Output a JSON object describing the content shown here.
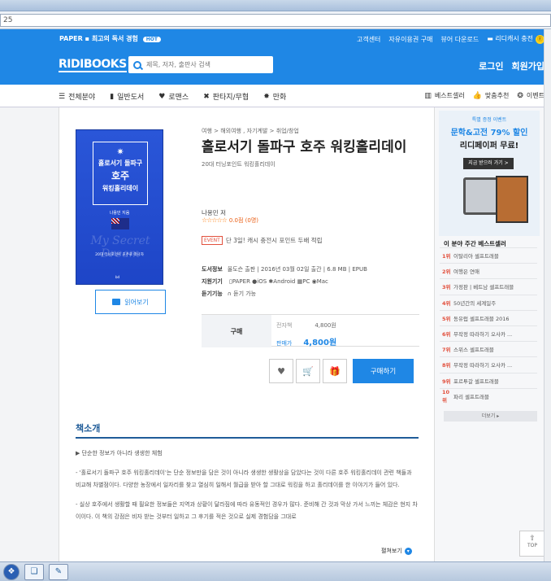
{
  "browser": {
    "address": "25"
  },
  "topstrip": {
    "paper": "PAPER",
    "tagline": "최고의 독서 경험",
    "hot": "HOT",
    "links": [
      "고객센터",
      "자유이용권 구매",
      "뷰어 다운로드"
    ],
    "cash_charge": "리디캐시 충전",
    "coin": "Ⓡ"
  },
  "header": {
    "logo": "RIDIBOOKS",
    "search_placeholder": "제목, 저자, 출판사 검색",
    "login": "로그인",
    "signup": "회원가입"
  },
  "nav": {
    "left": [
      {
        "label": "전체분야",
        "icon": "menu-icon"
      },
      {
        "label": "일반도서",
        "icon": "book-icon"
      },
      {
        "label": "로맨스",
        "icon": "heart-icon"
      },
      {
        "label": "판타지/무협",
        "icon": "swords-icon"
      },
      {
        "label": "만화",
        "icon": "burst-icon"
      }
    ],
    "right": [
      {
        "label": "베스트셀러",
        "icon": "chart-icon"
      },
      {
        "label": "맞춤추천",
        "icon": "thumb-icon"
      },
      {
        "label": "이벤트",
        "icon": "gift-icon"
      }
    ]
  },
  "book": {
    "cover": {
      "star": "✷",
      "title1": "홀로서기 돌파구",
      "title2": "호주",
      "title3": "워킹홀리데이",
      "author": "나용민 지음",
      "dream": "My Secret Dream",
      "sub": "20대 터닝포인트 호주로 떠나자",
      "pub": "bd"
    },
    "preview_label": "읽어보기",
    "breadcrumb": "여행 > 해외여행 , 자기계발 > 취업/창업",
    "title": "홀로서기 돌파구 호주 워킹홀리데이",
    "subtitle": "20대 터닝포인트 워킹홀리데이",
    "author": "나용민 저",
    "stars": "☆☆☆☆☆",
    "rating_text": "0.0점 (0명)",
    "event_tag": "EVENT",
    "event_text": "단 3일! 캐시 충전시 포인트 두배 적립",
    "meta": {
      "info_label": "도서정보",
      "info_value": "올도슨 출판 | 2016년 03월 02일 출간 | 6.8 MB | EPUB",
      "devices_label": "지원기기",
      "devices": [
        "PAPER",
        "iOS",
        "Android",
        "PC",
        "Mac"
      ],
      "listen_label": "듣기기능",
      "listen_value": "듣기 가능"
    },
    "buy": {
      "label": "구매",
      "ebook_price_label": "전자책",
      "ebook_price": "4,800원",
      "sale_label": "판매가",
      "sale_price": "4,800원",
      "buy_button": "구매하기"
    }
  },
  "intro": {
    "title": "책소개",
    "paragraphs": [
      "▶ 단순한 정보가 아니라 생생한 체험",
      "- '홀로서기 돌파구 호주 워킹홀리데이'는 단순 정보만을 담은 것이 아니라 생생한 생활상을 담았다는 것이 다른 호주 워킹홀리데이 관련 책들과 비교해 차별점이다. 다양한 농장에서 일자리를 찾고 열심히 일해서 월급을 받아 할 그대로 워킹을 하고 홀리데이를 한 이야기가 들어 있다.",
      "- 실상 호주에서 생활할 때 필요한 정보들은 지역과 상황이 달라짐에 따라 유동적인 경우가 많다. 준비해 간 것과 막상 가서 느끼는 체감은 현지 차이이다. 이 책의 강점은 비자 받는 것부터 일하고 그 후기를 적은 것으로 실제 경험담을 그대로"
    ],
    "more": "펼쳐보기"
  },
  "side": {
    "promo": {
      "line1": "특별 증정 이벤트",
      "line2": "문학&고전 79% 할인",
      "line3": "리디페이퍼 무료!",
      "button": "지금 받으러 가기 >"
    },
    "best_title": "이 분야 주간 베스트셀러",
    "best_list": [
      {
        "rank": "1위",
        "title": "이탈리아 셀프트래블"
      },
      {
        "rank": "2위",
        "title": "여행은 연애"
      },
      {
        "rank": "3위",
        "title": "가정판 | 베트남 셀프트래블"
      },
      {
        "rank": "4위",
        "title": "50년간의 세계일주"
      },
      {
        "rank": "5위",
        "title": "동유럽 셀프트래블 2016"
      },
      {
        "rank": "6위",
        "title": "무작정 따라하기 오사카 ..."
      },
      {
        "rank": "7위",
        "title": "스위스 셀프트래블"
      },
      {
        "rank": "8위",
        "title": "무작정 따라하기 오사카 ..."
      },
      {
        "rank": "9위",
        "title": "포르투갈 셀프트래블"
      },
      {
        "rank": "10위",
        "title": "파리 셀프트래블"
      }
    ],
    "more": "더보기 ▸"
  },
  "top_button": "TOP"
}
